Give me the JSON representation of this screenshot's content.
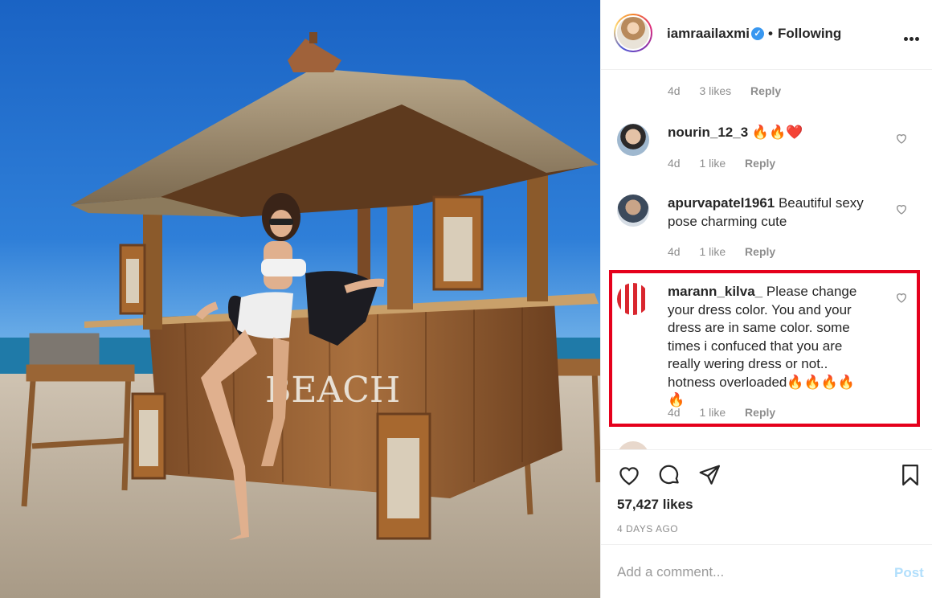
{
  "post": {
    "username": "iamraailaxmi",
    "verified_mark": "✓",
    "separator": "•",
    "follow_status": "Following",
    "sign_text": "BEACH"
  },
  "comments": [
    {
      "user": "",
      "text": "",
      "age": "4d",
      "likes": "3 likes",
      "reply": "Reply"
    },
    {
      "user": "nourin_12_3",
      "text": " 🔥🔥❤️",
      "age": "4d",
      "likes": "1 like",
      "reply": "Reply"
    },
    {
      "user": "apurvapatel1961",
      "text": " Beautiful sexy pose charming cute",
      "age": "4d",
      "likes": "1 like",
      "reply": "Reply"
    },
    {
      "user": "marann_kilva_",
      "text": " Please change your dress color. You and your dress are in same color. some times i confuced that you are really wering dress or not.. hotness overloaded🔥🔥🔥🔥🔥",
      "age": "4d",
      "likes": "1 like",
      "reply": "Reply"
    }
  ],
  "engagement": {
    "likes": "57,427 likes",
    "date": "4 DAYS AGO"
  },
  "composer": {
    "placeholder": "Add a comment...",
    "post_label": "Post"
  },
  "icons": {
    "like": "heart-icon",
    "comment": "comment-icon",
    "share": "share-icon",
    "save": "bookmark-icon",
    "more": "more-options-icon",
    "comment_like": "heart-outline-icon"
  },
  "colors": {
    "highlight": "#e5001c",
    "verified": "#3897f0",
    "post_button": "#b2dffc",
    "muted_text": "#8e8e8e"
  }
}
